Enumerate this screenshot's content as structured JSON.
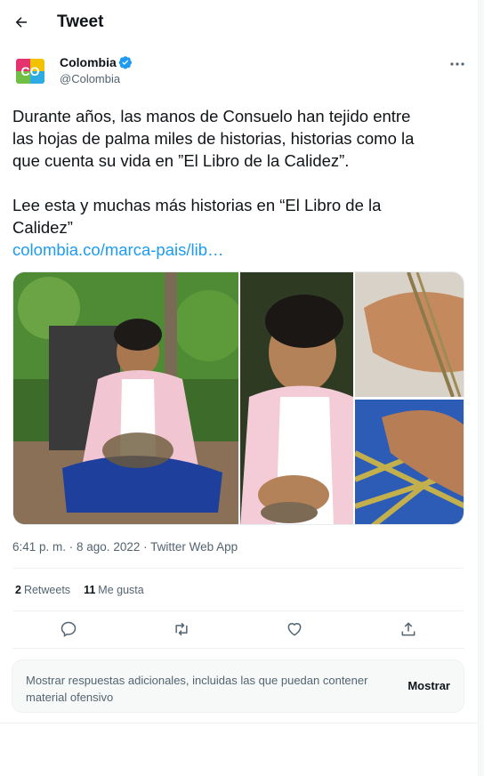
{
  "header": {
    "title": "Tweet"
  },
  "author": {
    "name": "Colombia",
    "handle": "@Colombia",
    "avatar_text": "CO"
  },
  "tweet": {
    "line1": "Durante años, las manos de Consuelo han tejido entre",
    "line2": "las hojas de palma miles de historias, historias como la",
    "line3": "que cuenta su vida en ”El Libro de la Calidez”.",
    "line4": "Lee esta y muchas más historias en “El Libro de la",
    "line5": "Calidez”",
    "link": "colombia.co/marca-pais/lib…"
  },
  "meta": {
    "timestamp": "6:41 p. m. · 8 ago. 2022 · Twitter Web App"
  },
  "stats": {
    "retweets_count": "2",
    "retweets_label": "Retweets",
    "likes_count": "11",
    "likes_label": "Me gusta"
  },
  "banner": {
    "line1": "Mostrar respuestas adicionales, incluidas las que puedan contener",
    "line2": "material ofensivo",
    "button": "Mostrar"
  },
  "colors": {
    "accent": "#1d9bf0",
    "text": "#0f1419",
    "muted": "#536471"
  },
  "icons": [
    "back-arrow-icon",
    "verified-badge-icon",
    "more-icon",
    "reply-icon",
    "retweet-icon",
    "like-icon",
    "share-icon"
  ]
}
